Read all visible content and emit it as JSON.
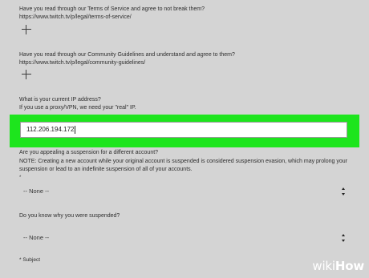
{
  "tos": {
    "question": "Have you read through our Terms of Service and agree to not break them?",
    "url": "https://www.twitch.tv/p/legal/terms-of-service/",
    "expand_icon": "plus-icon"
  },
  "guidelines": {
    "question": "Have you read through our Community Guidelines and understand and agree to them?",
    "url": "https://www.twitch.tv/p/legal/community-guidelines/",
    "expand_icon": "plus-icon"
  },
  "ip": {
    "question": "What is your current IP address?",
    "hint": "If you use a proxy/VPN, we need your \"real\" IP.",
    "value": "112.206.194.172"
  },
  "suspension_other": {
    "question": "Are you appealing a suspension for a different account?",
    "note_line1": "NOTE: Creating a new account while your original account is suspended is considered suspension evasion, which may prolong your",
    "note_line2": "suspension or lead to an indefinite suspension of all of your accounts.",
    "required_mark": "*",
    "selected": "-- None --"
  },
  "suspension_reason": {
    "question": "Do you know why you were suspended?",
    "selected": "-- None --"
  },
  "subject": {
    "label": "* Subject"
  },
  "watermark": {
    "wiki": "wiki",
    "how": "How"
  },
  "colors": {
    "background": "#d4d4d4",
    "highlight": "#1de51d"
  }
}
